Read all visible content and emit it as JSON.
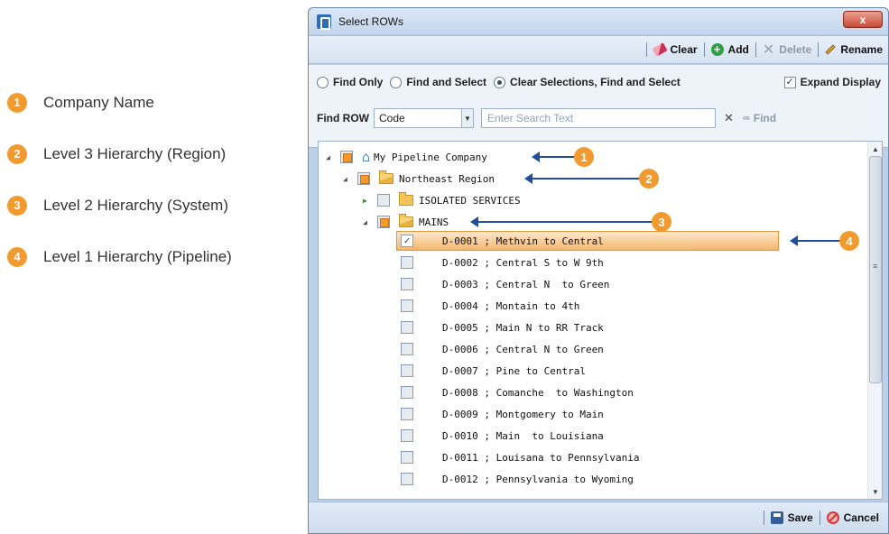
{
  "legend": [
    {
      "num": "1",
      "label": "Company Name"
    },
    {
      "num": "2",
      "label": "Level 3 Hierarchy (Region)"
    },
    {
      "num": "3",
      "label": "Level 2 Hierarchy (System)"
    },
    {
      "num": "4",
      "label": "Level 1 Hierarchy (Pipeline)"
    }
  ],
  "window": {
    "title": "Select ROWs",
    "close_glyph": "x"
  },
  "toolbar": {
    "clear": "Clear",
    "add": "Add",
    "delete": "Delete",
    "rename": "Rename"
  },
  "options": {
    "radio1": "Find Only",
    "radio2": "Find and Select",
    "radio3": "Clear Selections, Find and Select",
    "selected_radio": "Clear Selections, Find and Select",
    "expand_display": "Expand Display",
    "expand_checked": true,
    "find_label": "Find ROW",
    "find_field": "Code",
    "search_placeholder": "Enter Search Text",
    "find_button": "Find"
  },
  "tree": {
    "company": "My Pipeline Company",
    "region": "Northeast Region",
    "system_collapsed": "ISOLATED SERVICES",
    "system_open": "MAINS",
    "pipelines": [
      "D-0001 ; Methvin to Central",
      "D-0002 ; Central S to W 9th",
      "D-0003 ; Central N  to Green",
      "D-0004 ; Montain to 4th",
      "D-0005 ; Main N to RR Track",
      "D-0006 ; Central N to Green",
      "D-0007 ; Pine to Central",
      "D-0008 ; Comanche  to Washington",
      "D-0009 ; Montgomery to Main",
      "D-0010 ; Main  to Louisiana",
      "D-0011 ; Louisana to Pennsylvania",
      "D-0012 ; Pennsylvania to Wyoming"
    ],
    "checked_pipeline": "D-0001 ; Methvin to Central"
  },
  "callouts": [
    "1",
    "2",
    "3",
    "4"
  ],
  "footer": {
    "save": "Save",
    "cancel": "Cancel"
  },
  "colors": {
    "accent_orange": "#f39a2f",
    "callout_blue": "#1f4e9c",
    "window_blue": "#bcd0e8"
  }
}
